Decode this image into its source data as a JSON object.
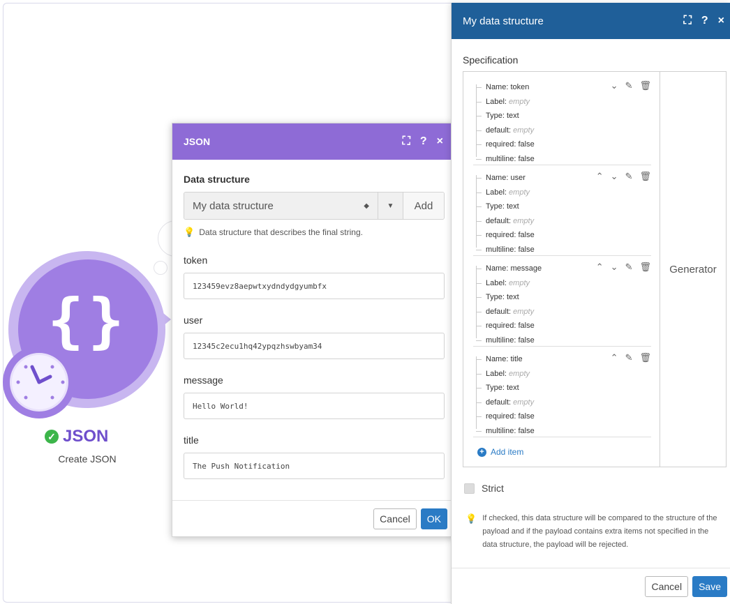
{
  "module": {
    "title": "JSON",
    "subtitle": "Create JSON",
    "icon": "json-braces-icon",
    "badge_icon": "clock-icon",
    "status_icon": "check-circle-icon",
    "braces": "{}",
    "colors": {
      "module": "#9f7ee3",
      "module_outer": "#c8b6f0",
      "title": "#6f4fcc",
      "status": "#3cb54a"
    }
  },
  "json_dialog": {
    "title": "JSON",
    "header_icons": [
      "expand-icon",
      "help-icon",
      "close-icon"
    ],
    "header_glyphs": {
      "expand": "⛶",
      "help": "?",
      "close": "×"
    },
    "data_structure": {
      "label": "Data structure",
      "selected": "My data structure",
      "add_label": "Add",
      "hint": "Data structure that describes the final string."
    },
    "fields": [
      {
        "label": "token",
        "value": "123459evz8aepwtxydndydgyumbfx"
      },
      {
        "label": "user",
        "value": "12345c2ecu1hq42ypqzhswbyam34"
      },
      {
        "label": "message",
        "value": "Hello World!"
      },
      {
        "label": "title",
        "value": "The Push Notification"
      }
    ],
    "cancel_label": "Cancel",
    "ok_label": "OK",
    "colors": {
      "header": "#8e6bd6",
      "primary": "#2a7bc5"
    }
  },
  "ds_panel": {
    "title": "My data structure",
    "header_icons": [
      "expand-icon",
      "help-icon",
      "close-icon"
    ],
    "header_glyphs": {
      "expand": "⛶",
      "help": "?",
      "close": "×"
    },
    "specification_label": "Specification",
    "generator_label": "Generator",
    "items": [
      {
        "name": "Name: token",
        "label_key": "Label:",
        "label_value": "empty",
        "type": "Type: text",
        "default_key": "default:",
        "default_value": "empty",
        "required": "required: false",
        "multiline": "multiline: false",
        "actions": [
          "chevron-down-icon",
          "edit-icon",
          "trash-icon"
        ]
      },
      {
        "name": "Name: user",
        "label_key": "Label:",
        "label_value": "empty",
        "type": "Type: text",
        "default_key": "default:",
        "default_value": "empty",
        "required": "required: false",
        "multiline": "multiline: false",
        "actions": [
          "chevron-up-icon",
          "chevron-down-icon",
          "edit-icon",
          "trash-icon"
        ]
      },
      {
        "name": "Name: message",
        "label_key": "Label:",
        "label_value": "empty",
        "type": "Type: text",
        "default_key": "default:",
        "default_value": "empty",
        "required": "required: false",
        "multiline": "multiline: false",
        "actions": [
          "chevron-up-icon",
          "chevron-down-icon",
          "edit-icon",
          "trash-icon"
        ]
      },
      {
        "name": "Name: title",
        "label_key": "Label:",
        "label_value": "empty",
        "type": "Type: text",
        "default_key": "default:",
        "default_value": "empty",
        "required": "required: false",
        "multiline": "multiline: false",
        "actions": [
          "chevron-up-icon",
          "edit-icon",
          "trash-icon"
        ]
      }
    ],
    "add_item_label": "Add item",
    "strict_label": "Strict",
    "strict_hint": "If checked, this data structure will be compared to the structure of the payload and if the payload contains extra items not specified in the data structure, the payload will be rejected.",
    "cancel_label": "Cancel",
    "save_label": "Save",
    "colors": {
      "header": "#1f5f99",
      "primary": "#2a7bc5",
      "link": "#2a7bc5"
    }
  }
}
